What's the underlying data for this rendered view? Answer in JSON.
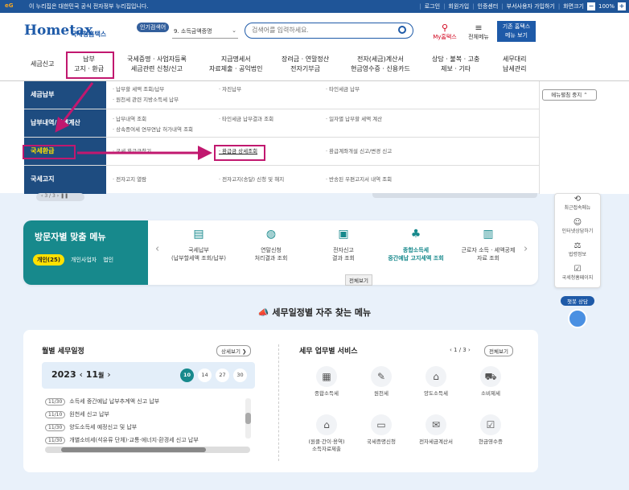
{
  "topbar": {
    "logo_text": "eG",
    "notice": "이 누리집은 대한민국 공식 전자정부 누리집입니다.",
    "links": [
      "로그인",
      "회원가입",
      "인증센터",
      "부서사용자 가입하기",
      "화면크기"
    ],
    "zoom": "100%",
    "zoom_minus": "−",
    "zoom_plus": "+"
  },
  "header": {
    "logo": "Hometax",
    "logo_sub": "국세청홈택스",
    "popular_label": "인기검색어",
    "popular_value": "9. 소득금액증명",
    "search_placeholder": "검색어를 입력하세요.",
    "my_home": "My홈택스",
    "all_menu": "전체메뉴",
    "basic_home_line1": "기존 홈택스",
    "basic_home_line2": "메뉴 보기"
  },
  "gnb": [
    {
      "l1": "세금신고",
      "l2": ""
    },
    {
      "l1": "납부",
      "l2": "고지 · 환급"
    },
    {
      "l1": "국세증명 · 사업자등록",
      "l2": "세금관련 신청/신고"
    },
    {
      "l1": "지급명세서",
      "l2": "자료제출 · 공익법인"
    },
    {
      "l1": "장려금 · 연말정산",
      "l2": "전자기부금"
    },
    {
      "l1": "전자(세금)계산서",
      "l2": "현금영수증 · 신용카드"
    },
    {
      "l1": "상담 · 불복 · 고충",
      "l2": "제보 · 기타"
    },
    {
      "l1": "세무대리",
      "l2": "납세관리"
    }
  ],
  "dropdown": {
    "stop_button": "메뉴펼침 중지 ⌃",
    "rows": [
      {
        "label": "세금납부",
        "c1": "· 납부할 세액 조회/납부",
        "c1b": "· 원천세 관련 지방소득세 납부",
        "c2": "· 자진납부",
        "c3": "· 타인세금 납부"
      },
      {
        "label": "납부내역/세액계산",
        "c1": "· 납부내역 조회",
        "c1b": "· 상속증여세 연부연납 허가내역 조회",
        "c2": "· 타인세금 납부결과 조회",
        "c3": "· 일자별 납부할 세액 계산"
      },
      {
        "label": "국세환급",
        "c1": "· 국세 환급금찾기",
        "c1b": "",
        "c2": "· 환급금 상세조회",
        "c3": "· 환급계좌개설 신고/변경 신고"
      },
      {
        "label": "국세고지",
        "c1": "· 전자고지 열람",
        "c1b": "",
        "c2": "· 전자고지(송달) 신청 및 해지",
        "c3": "· 반송된 우편고지서 내역 조회"
      }
    ]
  },
  "slider": {
    "counter": "3 / 3",
    "pause": "❚❚"
  },
  "visit": {
    "title": "방문자별 맞춤 메뉴",
    "chips": [
      "개인(25)",
      "개인사업자",
      "법인"
    ],
    "items": [
      {
        "icon": "doc-stamp-icon",
        "l1": "국세납부",
        "l2": "(납부할세액 조회/납부)"
      },
      {
        "icon": "money-bag-icon",
        "l1": "연말신청",
        "l2": "처리결과 조회"
      },
      {
        "icon": "doc-check-icon",
        "l1": "전자신고",
        "l2": "결과 조회"
      },
      {
        "icon": "hands-icon",
        "l1": "종합소득세",
        "l2": "중간예납 고지세액 조회"
      },
      {
        "icon": "print-icon",
        "l1": "근로자 소득 · 세액공제",
        "l2": "자료 조회"
      }
    ],
    "more_button": "전체보기"
  },
  "quick": [
    {
      "icon": "recent-icon",
      "label": "최근접속메뉴"
    },
    {
      "icon": "people-icon",
      "label": "인터넷상담하기"
    },
    {
      "icon": "gavel-icon",
      "label": "법령정보"
    },
    {
      "icon": "check-icon",
      "label": "국세청홈페이지"
    }
  ],
  "chatbot": "챗봇 상담",
  "section_title": "세무일정별 자주 찾는 메뉴",
  "schedule": {
    "title": "월별 세무일정",
    "detail_button": "상세보기 ❯",
    "year": "2023",
    "month": "11",
    "month_suffix": "월",
    "days": [
      "10",
      "14",
      "27",
      "30"
    ],
    "active_day": "10",
    "rows": [
      {
        "date": "11/30",
        "text": "소득세 중간예납 납부추계액 신고 납부"
      },
      {
        "date": "11/10",
        "text": "원천세 신고 납부"
      },
      {
        "date": "11/30",
        "text": "양도소득세 예정신고 및 납부"
      },
      {
        "date": "11/30",
        "text": "개별소비세(석유류 단체)·교통·에너지·환경세 신고 납부"
      }
    ]
  },
  "services": {
    "title": "세무 업무별 서비스",
    "pager": "1 / 3",
    "all_button": "전체보기",
    "items": [
      {
        "icon": "tax-calc-icon",
        "l1": "종합소득세",
        "l2": ""
      },
      {
        "icon": "wage-icon",
        "l1": "원천세",
        "l2": ""
      },
      {
        "icon": "house-money-icon",
        "l1": "양도소득세",
        "l2": ""
      },
      {
        "icon": "cart-icon",
        "l1": "소비제세",
        "l2": ""
      },
      {
        "icon": "building-icon",
        "l1": "(원클·간이·용역)",
        "l2": "소득자료제출"
      },
      {
        "icon": "id-card-icon",
        "l1": "국세증명신청",
        "l2": ""
      },
      {
        "icon": "invoice-icon",
        "l1": "전자세금계산서",
        "l2": ""
      },
      {
        "icon": "receipt-icon",
        "l1": "현금영수증",
        "l2": ""
      }
    ]
  },
  "colors": {
    "brand": "#1e5aa8",
    "highlight": "#c1186f",
    "teal": "#17898c"
  }
}
